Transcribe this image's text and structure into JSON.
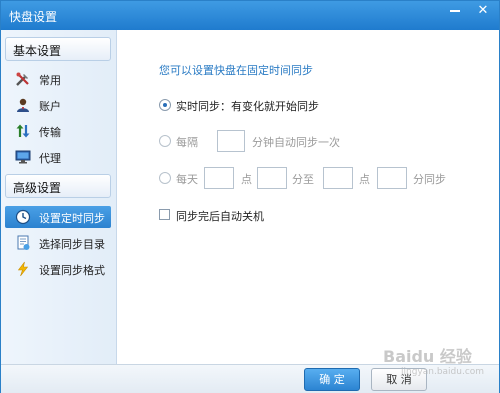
{
  "window": {
    "title": "快盘设置"
  },
  "sidebar": {
    "basic_header": "基本设置",
    "basic_items": [
      {
        "label": "常用",
        "icon": "tools-icon"
      },
      {
        "label": "账户",
        "icon": "user-icon"
      },
      {
        "label": "传输",
        "icon": "transfer-arrows-icon"
      },
      {
        "label": "代理",
        "icon": "monitor-icon"
      }
    ],
    "advanced_header": "高级设置",
    "advanced_items": [
      {
        "label": "设置定时同步",
        "icon": "clock-icon",
        "active": true
      },
      {
        "label": "选择同步目录",
        "icon": "folder-document-icon"
      },
      {
        "label": "设置同步格式",
        "icon": "lightning-icon"
      }
    ]
  },
  "content": {
    "heading": "您可以设置快盘在固定时间同步",
    "realtime_label": "实时同步：有变化就开始同步",
    "interval_label_prefix": "每隔",
    "interval_label_suffix": "分钟自动同步一次",
    "daily_prefix": "每天",
    "daily_point_1": "点",
    "daily_to": "分至",
    "daily_point_2": "点",
    "daily_suffix": "分同步",
    "shutdown_label": "同步完后自动关机",
    "interval_value": "",
    "daily_start_hour": "",
    "daily_start_min": "",
    "daily_end_hour": "",
    "daily_end_min": ""
  },
  "footer": {
    "ok_label": "确 定",
    "cancel_label": "取 消"
  },
  "watermark": {
    "line1": "Baidu 经验",
    "line2": "jingyan.baidu.com"
  },
  "colors": {
    "title_bar": "#2a86d6",
    "accent": "#2a7bc4",
    "active_item": "#3b91dc"
  }
}
